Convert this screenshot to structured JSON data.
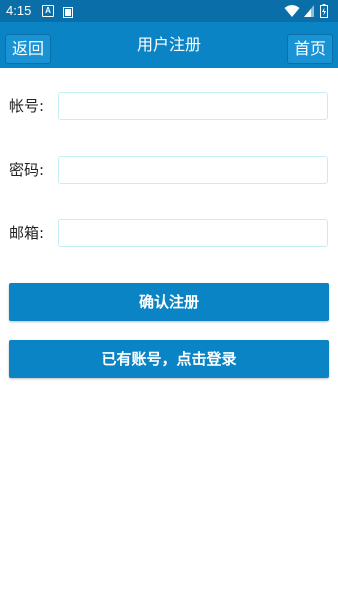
{
  "status_bar": {
    "time": "4:15",
    "icons": [
      "a-notification-icon",
      "book-icon",
      "wifi-icon",
      "signal-icon",
      "battery-icon"
    ]
  },
  "app_bar": {
    "back_label": "返回",
    "title": "用户注册",
    "home_label": "首页"
  },
  "form": {
    "account": {
      "label": "帐号:",
      "value": "",
      "placeholder": ""
    },
    "password": {
      "label": "密码:",
      "value": "",
      "placeholder": ""
    },
    "email": {
      "label": "邮箱:",
      "value": "",
      "placeholder": ""
    }
  },
  "actions": {
    "register_label": "确认注册",
    "login_label": "已有账号，点击登录"
  },
  "colors": {
    "status_bar": "#0a6ea8",
    "app_bar": "#0b84c6",
    "button": "#0b84c6",
    "input_border": "#c4eef4"
  }
}
